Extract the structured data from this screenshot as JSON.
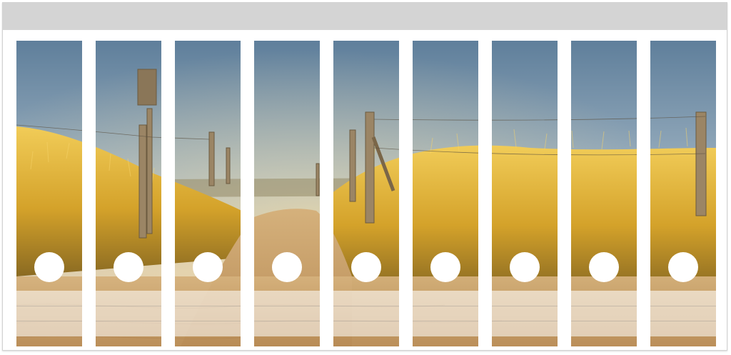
{
  "image": {
    "subject": "sand-dune-path-with-fence-at-sunset",
    "sky_color": "#6f8da6",
    "grass_color": "#d9a62a",
    "sand_color": "#c9a067"
  },
  "spines": {
    "count": 9,
    "has_finger_holes": true
  }
}
